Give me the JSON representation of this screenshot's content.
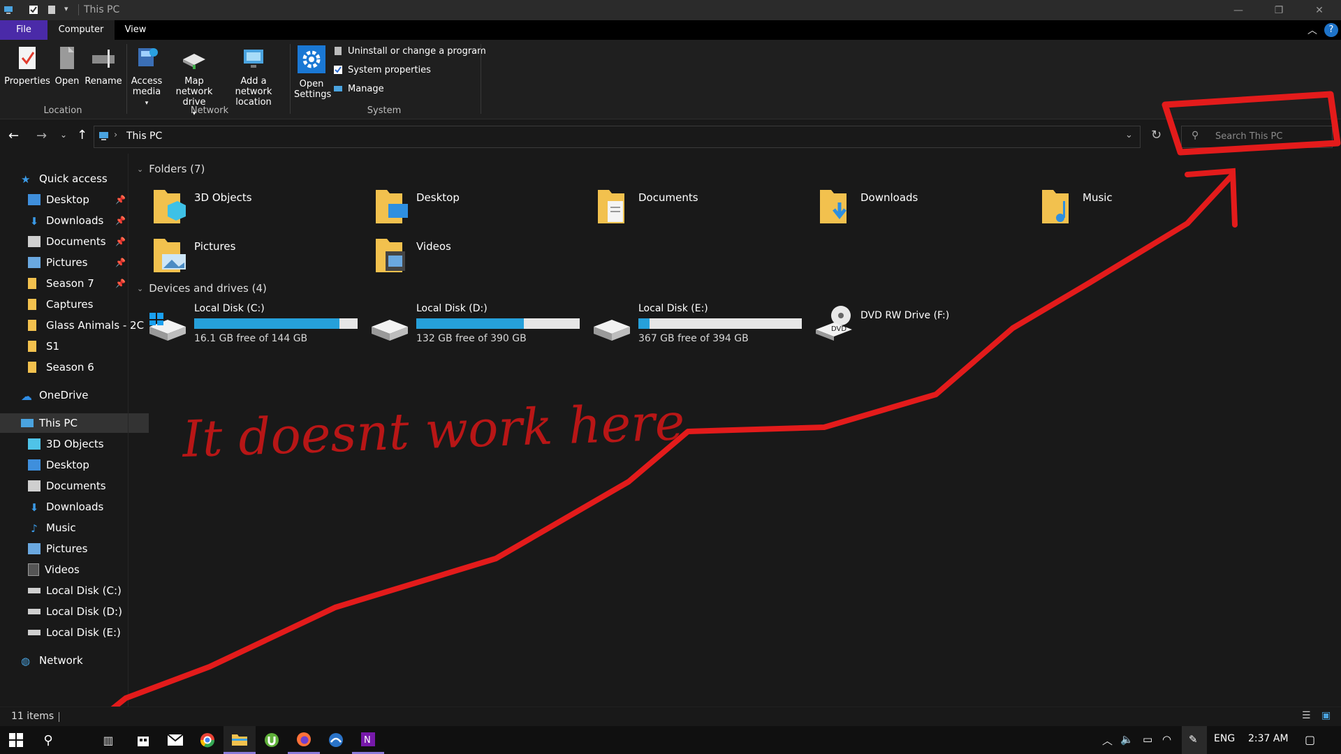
{
  "window": {
    "title": "This PC"
  },
  "ribbon": {
    "tabs": [
      "File",
      "Computer",
      "View"
    ],
    "groups": {
      "location": {
        "label": "Location",
        "buttons": [
          "Properties",
          "Open",
          "Rename"
        ]
      },
      "network": {
        "label": "Network",
        "access_media": "Access media",
        "map_drive": "Map network drive",
        "add_location": "Add a network location"
      },
      "system": {
        "label": "System",
        "open_settings": "Open Settings",
        "uninstall": "Uninstall or change a program",
        "system_props": "System properties",
        "manage": "Manage"
      }
    }
  },
  "address": {
    "path": "This PC",
    "search_placeholder": "Search This PC"
  },
  "sidebar": {
    "quick_access": "Quick access",
    "quick_items": [
      "Desktop",
      "Downloads",
      "Documents",
      "Pictures",
      "Season 7",
      "Captures",
      "Glass Animals - 2C",
      "S1",
      "Season 6"
    ],
    "onedrive": "OneDrive",
    "this_pc": "This PC",
    "pc_items": [
      "3D Objects",
      "Desktop",
      "Documents",
      "Downloads",
      "Music",
      "Pictures",
      "Videos",
      "Local Disk (C:)",
      "Local Disk (D:)",
      "Local Disk (E:)"
    ],
    "network": "Network"
  },
  "main": {
    "folders_header": "Folders (7)",
    "folders": [
      "3D Objects",
      "Desktop",
      "Documents",
      "Downloads",
      "Music",
      "Pictures",
      "Videos"
    ],
    "drives_header": "Devices and drives (4)",
    "drives": [
      {
        "name": "Local Disk (C:)",
        "free": "16.1 GB free of 144 GB",
        "used_fraction": 0.89
      },
      {
        "name": "Local Disk (D:)",
        "free": "132 GB free of 390 GB",
        "used_fraction": 0.66
      },
      {
        "name": "Local Disk (E:)",
        "free": "367 GB free of 394 GB",
        "used_fraction": 0.07
      }
    ],
    "dvd": "DVD RW Drive (F:)"
  },
  "annotation": {
    "text": "It doesnt work here",
    "color": "#e31b1b"
  },
  "status": {
    "items": "11 items"
  },
  "taskbar": {
    "lang": "ENG",
    "time": "2:37 AM"
  },
  "colors": {
    "accent_file_tab": "#4a2aa8",
    "drive_bar": "#26a0da",
    "folder": "#f2c14e"
  }
}
